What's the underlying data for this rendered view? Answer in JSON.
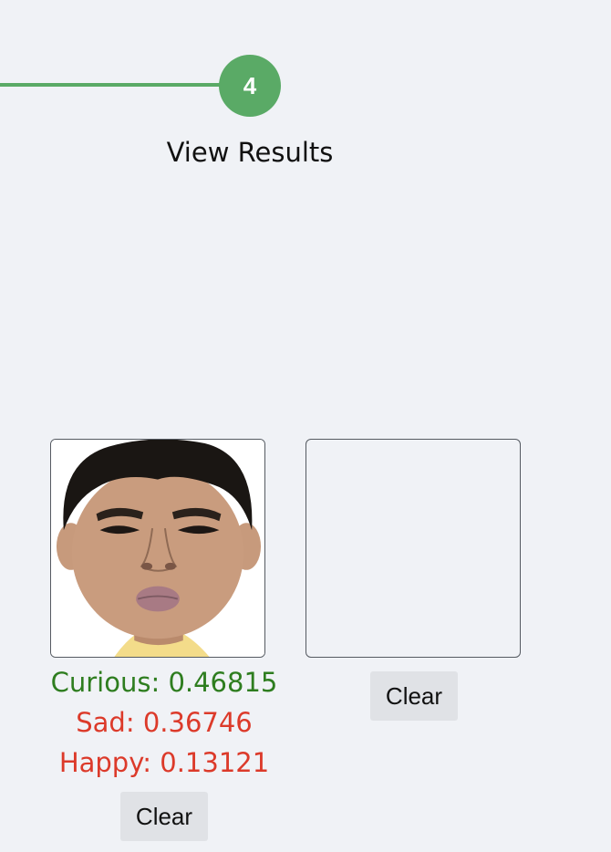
{
  "stepper": {
    "step_number": "4",
    "step_label": "View Results",
    "accent_color": "#5aaa66"
  },
  "image_slots": [
    {
      "has_image": true,
      "image_content": "face-photo",
      "results": [
        {
          "label": "Curious: 0.46815",
          "color": "#2e7d1f"
        },
        {
          "label": "Sad: 0.36746",
          "color": "#dc3a2a"
        },
        {
          "label": "Happy: 0.13121",
          "color": "#dc3a2a"
        }
      ],
      "clear_label": "Clear"
    },
    {
      "has_image": false,
      "results": [],
      "clear_label": "Clear"
    }
  ]
}
